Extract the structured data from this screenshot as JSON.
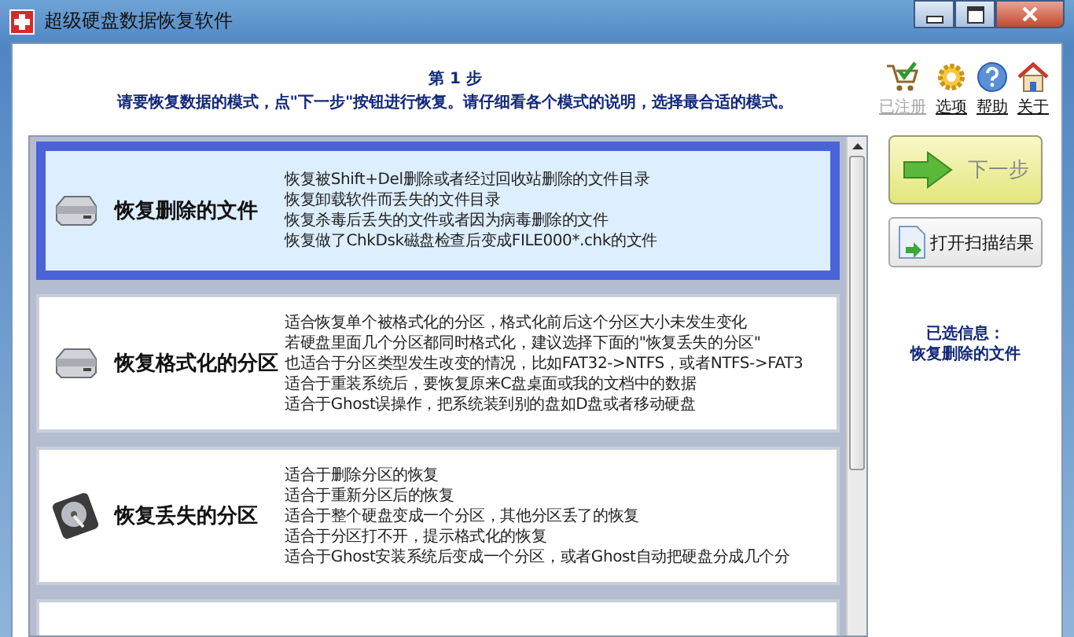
{
  "window": {
    "title": "超级硬盘数据恢复软件"
  },
  "header": {
    "step": "第 1 步",
    "instruction": "请要恢复数据的模式，点\"下一步\"按钮进行恢复。请仔细看各个模式的说明，选择最合适的模式。"
  },
  "toolbar": [
    {
      "label": "已注册",
      "kind": "cart",
      "disabled": true
    },
    {
      "label": "选项",
      "kind": "gear",
      "disabled": false
    },
    {
      "label": "帮助",
      "kind": "help",
      "disabled": false
    },
    {
      "label": "关于",
      "kind": "home",
      "disabled": false
    }
  ],
  "modes": [
    {
      "title": "恢复删除的文件",
      "kind": "drive",
      "selected": true,
      "lines": [
        "恢复被Shift+Del删除或者经过回收站删除的文件目录",
        "恢复卸载软件而丢失的文件目录",
        "恢复杀毒后丢失的文件或者因为病毒删除的文件",
        "恢复做了ChkDsk磁盘检查后变成FILE000*.chk的文件"
      ]
    },
    {
      "title": "恢复格式化的分区",
      "kind": "drive",
      "selected": false,
      "lines": [
        "适合恢复单个被格式化的分区，格式化前后这个分区大小未发生变化",
        "若硬盘里面几个分区都同时格式化，建议选择下面的\"恢复丢失的分区\"",
        "也适合于分区类型发生改变的情况，比如FAT32->NTFS，或者NTFS->FAT3",
        "适合于重装系统后，要恢复原来C盘桌面或我的文档中的数据",
        "适合于Ghost误操作，把系统装到别的盘如D盘或者移动硬盘"
      ]
    },
    {
      "title": "恢复丢失的分区",
      "kind": "disk",
      "selected": false,
      "lines": [
        "适合于删除分区的恢复",
        "适合于重新分区后的恢复",
        "适合于整个硬盘变成一个分区，其他分区丢了的恢复",
        "适合于分区打不开，提示格式化的恢复",
        "适合于Ghost安装系统后变成一个分区，或者Ghost自动把硬盘分成几个分"
      ]
    }
  ],
  "next_button": {
    "label": "下一步",
    "disabled": true
  },
  "open_button": {
    "label": "打开扫描结果"
  },
  "selection_info": {
    "label": "已选信息：",
    "value": "恢复删除的文件"
  }
}
